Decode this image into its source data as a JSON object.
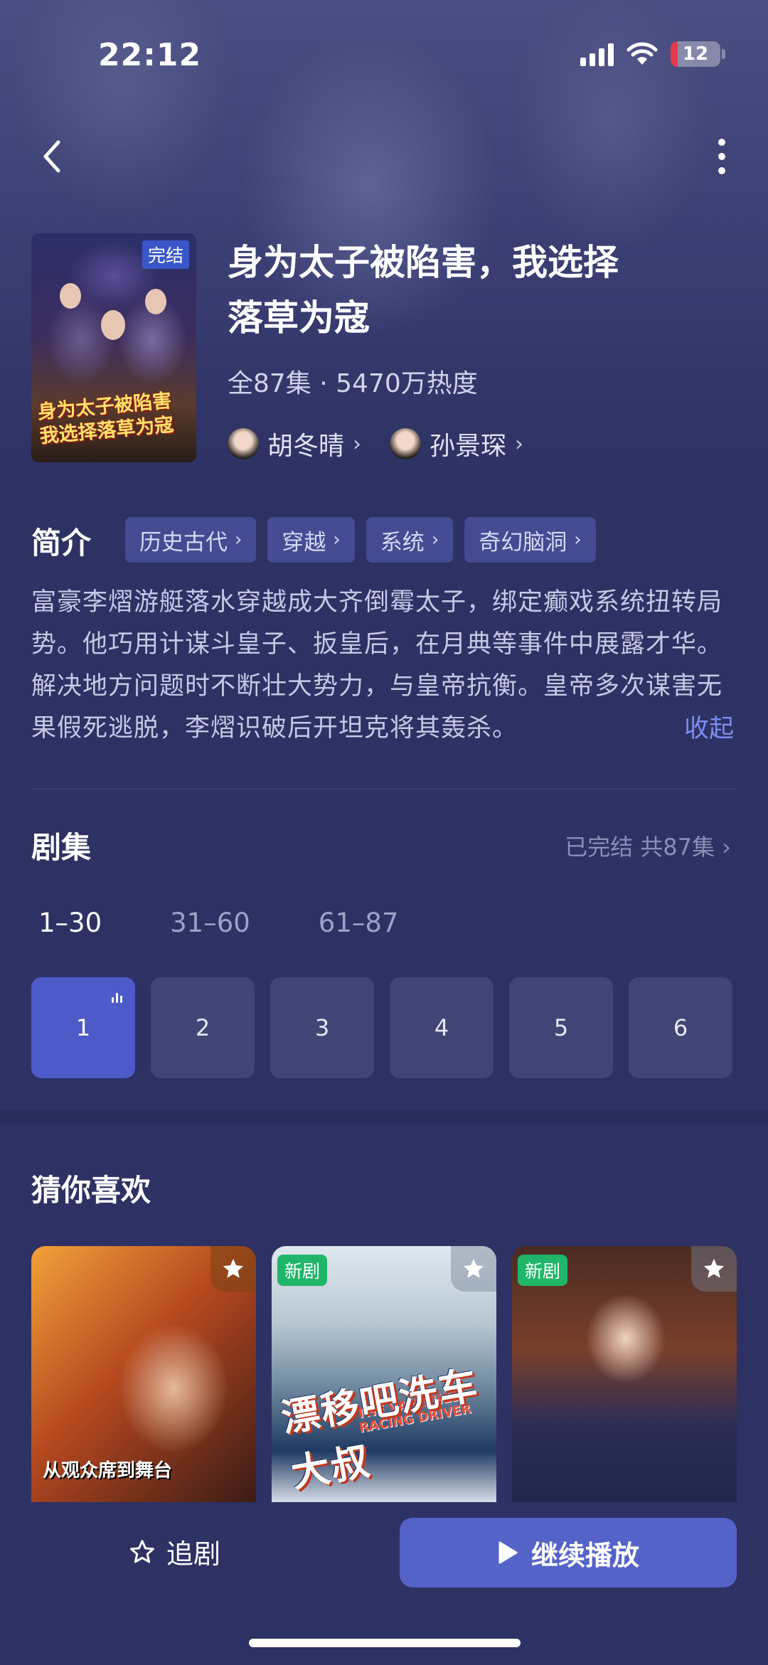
{
  "status_bar": {
    "time": "22:12",
    "battery": "12"
  },
  "drama": {
    "title_line1": "身为太子被陷害，我选择",
    "title_line2": "落草为寇",
    "meta": "全87集 · 5470万热度",
    "poster_badge": "完结",
    "poster_title_line1": "身为太子被陷害",
    "poster_title_line2": "我选择落草为寇",
    "actors": [
      {
        "name": "胡冬晴"
      },
      {
        "name": "孙景琛"
      }
    ]
  },
  "intro": {
    "heading": "简介",
    "tags": [
      "历史古代",
      "穿越",
      "系统",
      "奇幻脑洞"
    ],
    "synopsis": "富豪李熠游艇落水穿越成大齐倒霉太子，绑定癫戏系统扭转局势。他巧用计谋斗皇子、扳皇后，在月典等事件中展露才华。解决地方问题时不断壮大势力，与皇帝抗衡。皇帝多次谋害无果假死逃脱，李熠识破后开坦克将其轰杀。",
    "collapse_label": "收起"
  },
  "episodes": {
    "heading": "剧集",
    "summary": "已完结 共87集",
    "ranges": [
      "1–30",
      "31–60",
      "61–87"
    ],
    "active_range": 0,
    "items": [
      "1",
      "2",
      "3",
      "4",
      "5",
      "6"
    ],
    "current": "1"
  },
  "recommend": {
    "heading": "猜你喜欢",
    "cards": [
      {
        "badge": "",
        "caption": "从观众席到舞台"
      },
      {
        "badge": "新剧",
        "title_en": "THE VANISHED RACING DRIVER",
        "title_cn": "漂移吧洗车大叔"
      },
      {
        "badge": "新剧"
      }
    ]
  },
  "bottom_bar": {
    "follow_label": "追剧",
    "play_label": "继续播放"
  },
  "colors": {
    "background": "#2d3163",
    "accent": "#5563c8",
    "tag_bg": "#444b92",
    "new_badge": "#1fb66a"
  }
}
